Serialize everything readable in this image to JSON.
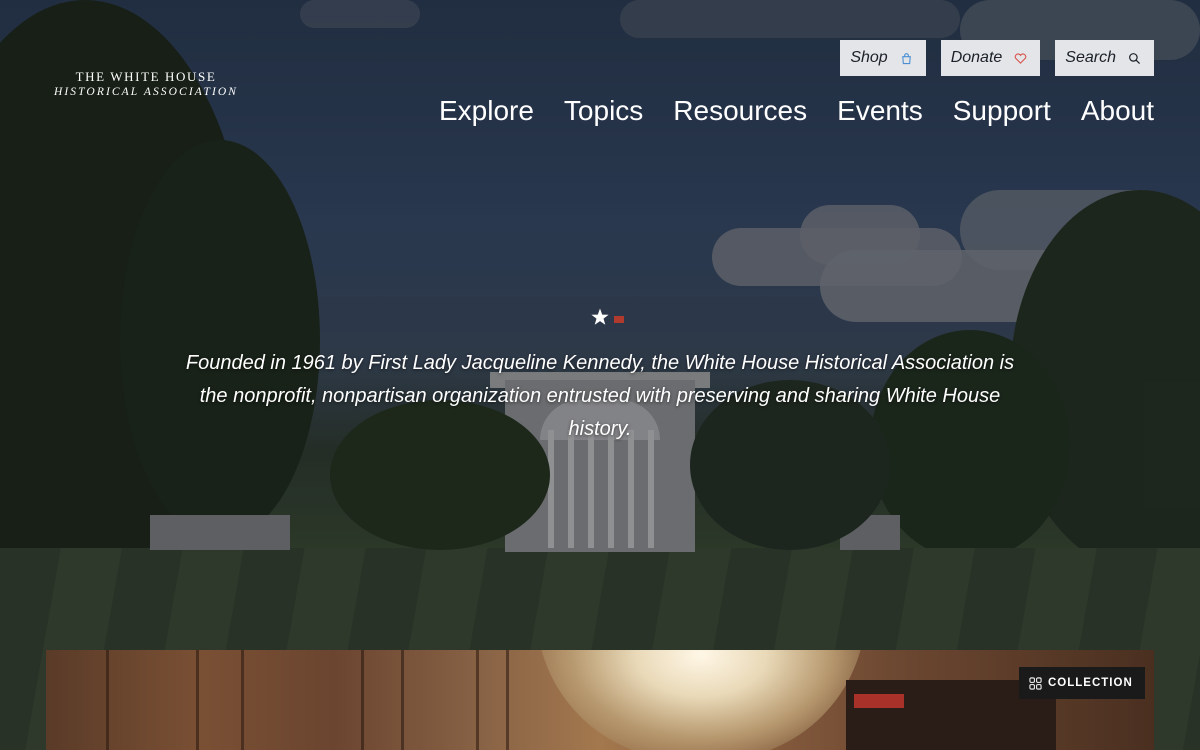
{
  "logo": {
    "line1": "THE WHITE HOUSE",
    "line2": "HISTORICAL ASSOCIATION"
  },
  "utility": [
    {
      "label": "Shop",
      "icon": "shopping-bag-icon"
    },
    {
      "label": "Donate",
      "icon": "heart-icon"
    },
    {
      "label": "Search",
      "icon": "search-icon"
    }
  ],
  "nav": {
    "items": [
      "Explore",
      "Topics",
      "Resources",
      "Events",
      "Support",
      "About"
    ]
  },
  "hero": {
    "mission": "Founded in 1961 by First Lady Jacqueline Kennedy, the White House Historical Association is the nonprofit, nonpartisan organization entrusted with preserving and sharing White House history."
  },
  "feature": {
    "badge_label": "COLLECTION",
    "badge_icon": "grid-icon"
  },
  "colors": {
    "utility_bg": "#e3e5e8",
    "shop_icon": "#4a8fd4",
    "donate_icon": "#d9534f",
    "badge_bg": "#1a1a1a"
  }
}
